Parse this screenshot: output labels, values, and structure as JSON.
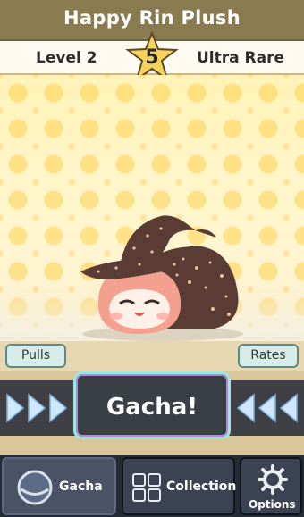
{
  "header": {
    "title": "Happy Rin Plush",
    "level": "Level 2",
    "rarity": "Ultra Rare",
    "star_number": "5"
  },
  "actions": {
    "pulls": "Pulls",
    "rates": "Rates",
    "gacha": "Gacha!"
  },
  "nav": {
    "gacha": "Gacha",
    "collection": "Collection",
    "options": "Options"
  },
  "colors": {
    "topbar": "#8a7a4f",
    "accent_teal": "#9ee7df",
    "nav_bg": "#262a33"
  },
  "icons": [
    "star-icon",
    "arrow-right-icon",
    "arrow-left-icon",
    "gacha-capsule-icon",
    "collection-grid-icon",
    "gear-icon"
  ]
}
